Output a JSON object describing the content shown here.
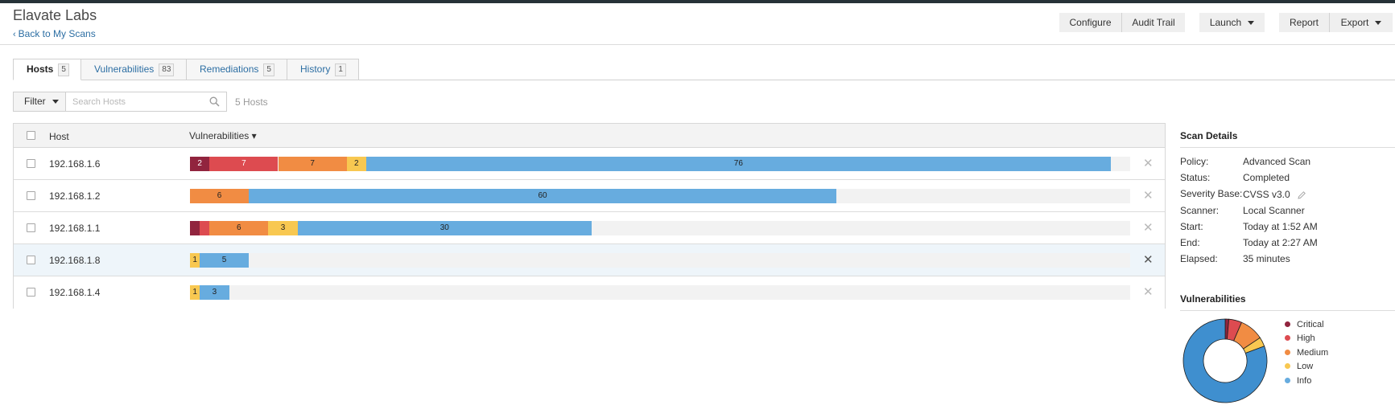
{
  "app": {
    "title": "Elavate Labs",
    "back_link": "Back to My Scans"
  },
  "toolbar": {
    "configure": "Configure",
    "audit_trail": "Audit Trail",
    "launch": "Launch",
    "report": "Report",
    "export": "Export"
  },
  "tabs": [
    {
      "label": "Hosts",
      "count": "5",
      "active": true
    },
    {
      "label": "Vulnerabilities",
      "count": "83",
      "active": false
    },
    {
      "label": "Remediations",
      "count": "5",
      "active": false
    },
    {
      "label": "History",
      "count": "1",
      "active": false
    }
  ],
  "filter": {
    "label": "Filter",
    "search_placeholder": "Search Hosts",
    "host_count": "5 Hosts"
  },
  "table": {
    "col_host": "Host",
    "col_vulnerabilities": "Vulnerabilities ▾",
    "rows": [
      {
        "host": "192.168.1.6",
        "critical": 2,
        "high": 7,
        "medium": 7,
        "low": 2,
        "info": 76,
        "labels": {
          "critical": "2",
          "high": "7",
          "medium": "7",
          "low": "2",
          "info": "76"
        }
      },
      {
        "host": "192.168.1.2",
        "critical": 0,
        "high": 0,
        "medium": 6,
        "low": 0,
        "info": 60,
        "labels": {
          "critical": "",
          "high": "",
          "medium": "6",
          "low": "",
          "info": "60"
        }
      },
      {
        "host": "192.168.1.1",
        "critical": 1,
        "high": 1,
        "medium": 6,
        "low": 3,
        "info": 30,
        "labels": {
          "critical": "",
          "high": "",
          "medium": "6",
          "low": "3",
          "info": "30"
        }
      },
      {
        "host": "192.168.1.8",
        "critical": 0,
        "high": 0,
        "medium": 0,
        "low": 1,
        "info": 5,
        "labels": {
          "critical": "",
          "high": "",
          "medium": "",
          "low": "1",
          "info": "5"
        }
      },
      {
        "host": "192.168.1.4",
        "critical": 0,
        "high": 0,
        "medium": 0,
        "low": 1,
        "info": 3,
        "labels": {
          "critical": "",
          "high": "",
          "medium": "",
          "low": "1",
          "info": "3"
        }
      }
    ]
  },
  "scan_details": {
    "title": "Scan Details",
    "items": [
      {
        "label": "Policy:",
        "value": "Advanced Scan"
      },
      {
        "label": "Status:",
        "value": "Completed"
      },
      {
        "label": "Severity Base:",
        "value": "CVSS v3.0"
      },
      {
        "label": "Scanner:",
        "value": "Local Scanner"
      },
      {
        "label": "Start:",
        "value": "Today at 1:52 AM"
      },
      {
        "label": "End:",
        "value": "Today at 2:27 AM"
      },
      {
        "label": "Elapsed:",
        "value": "35 minutes"
      }
    ]
  },
  "vuln_summary": {
    "title": "Vulnerabilities",
    "legend": [
      "Critical",
      "High",
      "Medium",
      "Low",
      "Info"
    ]
  },
  "chart_data": {
    "type": "pie",
    "donut": true,
    "categories": [
      "Critical",
      "High",
      "Medium",
      "Low",
      "Info"
    ],
    "values": [
      2,
      7,
      13,
      5,
      113
    ],
    "colors": [
      "#91243e",
      "#dd4b50",
      "#f18c43",
      "#f8c851",
      "#3f8fcf"
    ]
  },
  "colors": {
    "critical": "#91243e",
    "high": "#dd4b50",
    "medium": "#f18c43",
    "low": "#f8c851",
    "info": "#67acdf",
    "link": "#2c6ea3"
  }
}
